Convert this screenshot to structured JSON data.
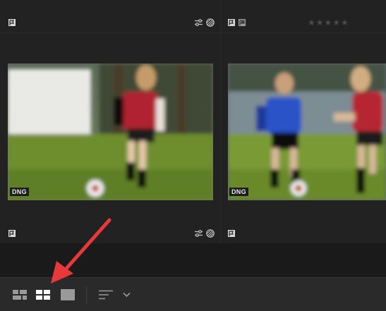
{
  "photos": [
    {
      "badge": "DNG"
    },
    {
      "badge": "DNG"
    }
  ],
  "rating": {
    "stars": "★★★★★"
  },
  "colors": {
    "accent_arrow": "#e8393a",
    "icon": "#c8c8c8",
    "icon_dim": "#9a9a9a",
    "toolbar_bg": "#2a2a2a"
  },
  "toolbar": {
    "view_buttons": [
      "mosaic-view-icon",
      "grid-view-icon",
      "single-view-icon"
    ],
    "sort_icon": "sort-lines-icon",
    "dropdown_icon": "chevron-down-icon"
  }
}
